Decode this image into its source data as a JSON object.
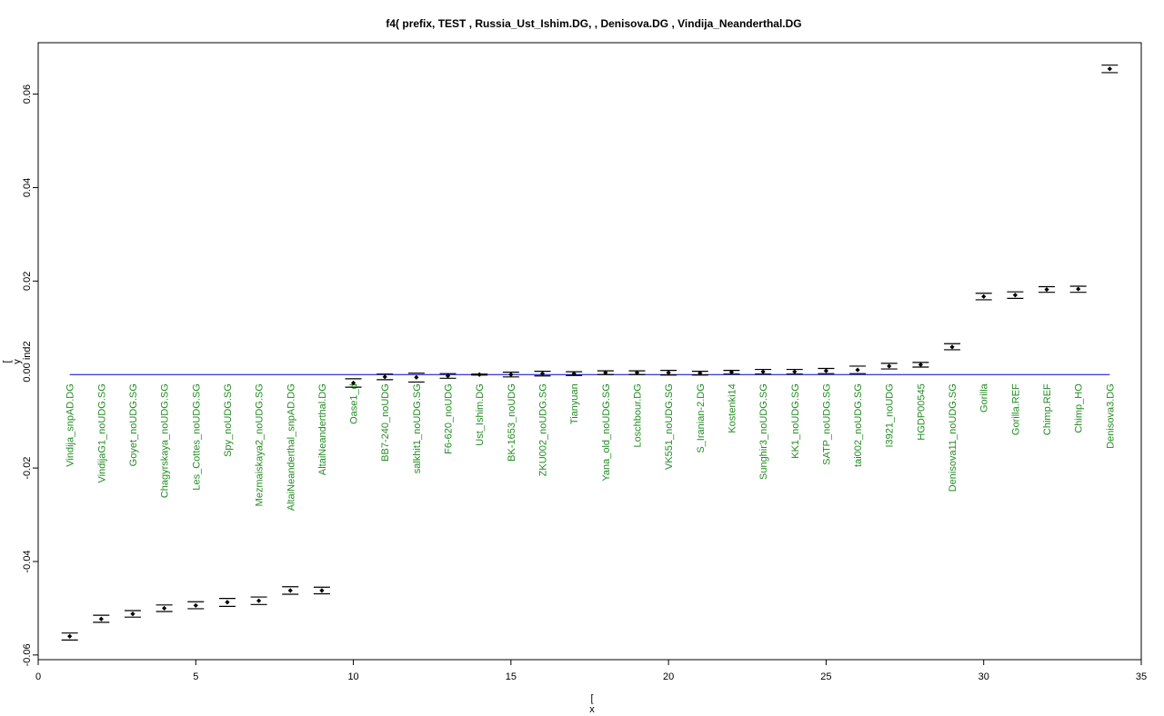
{
  "chart_data": {
    "type": "scatter",
    "title": "f4( prefix,  TEST ,  Russia_Ust_Ishim.DG, , Denisova.DG  , Vindija_Neanderthal.DG",
    "xlabel_lines": [
      "[",
      "x"
    ],
    "ylabel_lines": [
      "[",
      "y",
      "0.00 ind2"
    ],
    "xlim": [
      0,
      35
    ],
    "ylim": [
      -0.061,
      0.071
    ],
    "xticks": [
      0,
      5,
      10,
      15,
      20,
      25,
      30,
      35
    ],
    "yticks": [
      -0.06,
      -0.04,
      -0.02,
      0.02,
      0.04,
      0.06
    ],
    "ytick_labels": [
      "-0.06",
      "-0.04",
      "-0.02",
      "0.02",
      "0.04",
      "0.06"
    ],
    "grid": false,
    "reference_line": {
      "y": 0,
      "x_from": 1,
      "x_to": 34,
      "color": "#0000cc"
    },
    "label_color": "#228b22",
    "point_color": "#000000",
    "points": [
      {
        "x": 1,
        "y": -0.056,
        "lo": -0.0568,
        "hi": -0.0553,
        "label": "Vindija_snpAD.DG"
      },
      {
        "x": 2,
        "y": -0.0523,
        "lo": -0.053,
        "hi": -0.0515,
        "label": "VindijaG1_noUDG.SG"
      },
      {
        "x": 3,
        "y": -0.0512,
        "lo": -0.0519,
        "hi": -0.0505,
        "label": "Goyet_noUDG.SG"
      },
      {
        "x": 4,
        "y": -0.05,
        "lo": -0.0507,
        "hi": -0.0493,
        "label": "Chagyrskaya_noUDG.SG"
      },
      {
        "x": 5,
        "y": -0.0494,
        "lo": -0.0501,
        "hi": -0.0486,
        "label": "Les_Cottes_noUDG.SG"
      },
      {
        "x": 6,
        "y": -0.0487,
        "lo": -0.0496,
        "hi": -0.0479,
        "label": "Spy_noUDG.SG"
      },
      {
        "x": 7,
        "y": -0.0484,
        "lo": -0.0492,
        "hi": -0.0476,
        "label": "Mezmaiskaya2_noUDG.SG"
      },
      {
        "x": 8,
        "y": -0.0462,
        "lo": -0.047,
        "hi": -0.0454,
        "label": "AltaiNeanderthal_snpAD.DG"
      },
      {
        "x": 9,
        "y": -0.0462,
        "lo": -0.0469,
        "hi": -0.0455,
        "label": "AltaiNeanderthal.DG"
      },
      {
        "x": 10,
        "y": -0.0018,
        "lo": -0.0027,
        "hi": -0.0009,
        "label": "Oase1_d"
      },
      {
        "x": 11,
        "y": -0.0005,
        "lo": -0.0011,
        "hi": 0.0001,
        "label": "BB7-240_noUDG"
      },
      {
        "x": 12,
        "y": -0.0006,
        "lo": -0.0016,
        "hi": 0.0003,
        "label": "salkhit1_noUDG.SG"
      },
      {
        "x": 13,
        "y": -0.0003,
        "lo": -0.0008,
        "hi": 0.0002,
        "label": "F6-620_noUDG"
      },
      {
        "x": 14,
        "y": 0.0,
        "lo": -0.0001,
        "hi": 0.0001,
        "label": "Ust_Ishim.DG"
      },
      {
        "x": 15,
        "y": 0.0,
        "lo": -0.0005,
        "hi": 0.0005,
        "label": "BK-1653_noUDG"
      },
      {
        "x": 16,
        "y": 0.0002,
        "lo": -0.0003,
        "hi": 0.0007,
        "label": "ZKU002_noUDG.SG"
      },
      {
        "x": 17,
        "y": 0.0002,
        "lo": -0.0002,
        "hi": 0.0006,
        "label": "Tianyuan"
      },
      {
        "x": 18,
        "y": 0.0004,
        "lo": 0.0,
        "hi": 0.0008,
        "label": "Yana_old_noUDG.SG"
      },
      {
        "x": 19,
        "y": 0.0004,
        "lo": 0.0,
        "hi": 0.0008,
        "label": "Loschbour.DG"
      },
      {
        "x": 20,
        "y": 0.0004,
        "lo": -0.0001,
        "hi": 0.0009,
        "label": "VK551_noUDG.SG"
      },
      {
        "x": 21,
        "y": 0.0003,
        "lo": -0.0001,
        "hi": 0.0007,
        "label": "S_Iranian-2.DG"
      },
      {
        "x": 22,
        "y": 0.0005,
        "lo": 0.0001,
        "hi": 0.0009,
        "label": "Kostenki14"
      },
      {
        "x": 23,
        "y": 0.0006,
        "lo": 0.0001,
        "hi": 0.0011,
        "label": "Sunghir3_noUDG.SG"
      },
      {
        "x": 24,
        "y": 0.0006,
        "lo": 0.0001,
        "hi": 0.0011,
        "label": "KK1_noUDG.SG"
      },
      {
        "x": 25,
        "y": 0.0008,
        "lo": 0.0002,
        "hi": 0.0013,
        "label": "SATP_noUDG.SG"
      },
      {
        "x": 26,
        "y": 0.001,
        "lo": 0.0002,
        "hi": 0.0018,
        "label": "tai002_noUDG.SG"
      },
      {
        "x": 27,
        "y": 0.0018,
        "lo": 0.0012,
        "hi": 0.0024,
        "label": "I3921_noUDG"
      },
      {
        "x": 28,
        "y": 0.0021,
        "lo": 0.0016,
        "hi": 0.0026,
        "label": "HGDP00545"
      },
      {
        "x": 29,
        "y": 0.0059,
        "lo": 0.0053,
        "hi": 0.0066,
        "label": "Denisova11_noUDG.SG"
      },
      {
        "x": 30,
        "y": 0.0167,
        "lo": 0.016,
        "hi": 0.0174,
        "label": "Gorilla"
      },
      {
        "x": 31,
        "y": 0.017,
        "lo": 0.0163,
        "hi": 0.0177,
        "label": "Gorilla.REF"
      },
      {
        "x": 32,
        "y": 0.0182,
        "lo": 0.0176,
        "hi": 0.0188,
        "label": "Chimp.REF"
      },
      {
        "x": 33,
        "y": 0.0183,
        "lo": 0.0176,
        "hi": 0.0189,
        "label": "Chimp_HO"
      },
      {
        "x": 34,
        "y": 0.0654,
        "lo": 0.0646,
        "hi": 0.0662,
        "label": "Denisova3.DG"
      }
    ]
  }
}
